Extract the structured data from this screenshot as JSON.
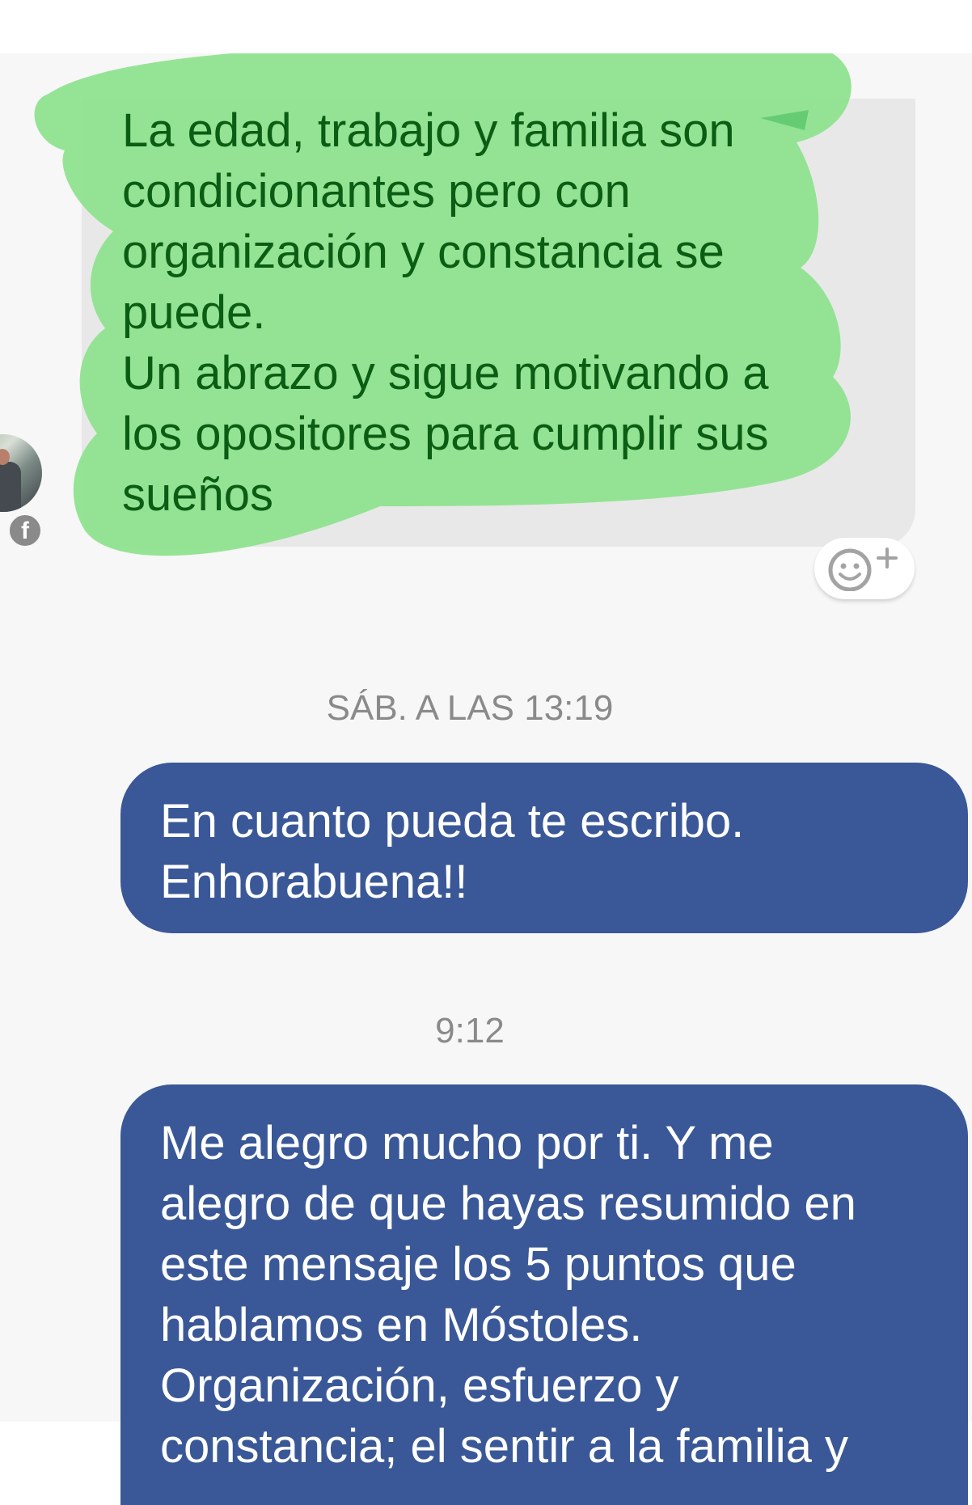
{
  "incoming": {
    "message": "La edad, trabajo y familia son\ncondicionantes pero con\norganización y constancia se\npuede.\nUn abrazo y sigue motivando a\nlos opositores para cumplir sus\nsueños",
    "highlight_color": "#8fe38f",
    "text_color": "#0b5d14",
    "bubble_color": "#e8e8e8"
  },
  "avatar": {
    "badge_icon": "facebook-icon",
    "badge_glyph": "f"
  },
  "reaction": {
    "icon": "add-reaction-icon"
  },
  "timestamps": {
    "first": "SÁB. A LAS 13:19",
    "second": "9:12"
  },
  "outgoing": [
    {
      "message": "En cuanto pueda te escribo.\nEnhorabuena!!"
    },
    {
      "message": "Me alegro mucho por ti. Y me\nalegro de que hayas resumido en\neste mensaje los 5 puntos que\nhablamos en Móstoles.\nOrganización, esfuerzo y\nconstancia; el sentir a la familia y"
    }
  ],
  "colors": {
    "outgoing_bubble": "#3a5897",
    "background": "#f7f7f7",
    "timestamp_text": "#8a8a8a"
  }
}
